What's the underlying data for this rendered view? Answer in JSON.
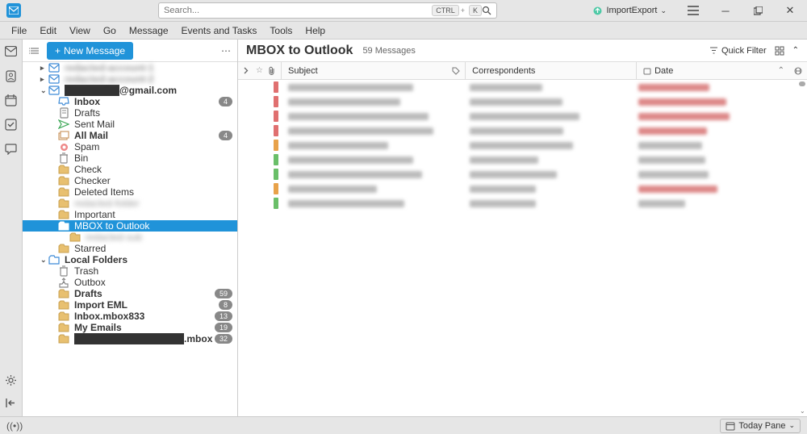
{
  "search": {
    "placeholder": "Search...",
    "kbd1": "CTRL",
    "kbd2": "K"
  },
  "titlebar": {
    "import_export": "ImportExport"
  },
  "menubar": [
    "File",
    "Edit",
    "View",
    "Go",
    "Message",
    "Events and Tasks",
    "Tools",
    "Help"
  ],
  "folder_toolbar": {
    "new_message": "New Message"
  },
  "accounts": [
    {
      "name": "redacted-account-1",
      "blurred": true
    },
    {
      "name": "redacted-account-2",
      "blurred": true
    },
    {
      "name": "@gmail.com",
      "bold": true,
      "folders": [
        {
          "label": "Inbox",
          "icon": "inbox",
          "bold": true,
          "badge": "4"
        },
        {
          "label": "Drafts",
          "icon": "drafts"
        },
        {
          "label": "Sent Mail",
          "icon": "sent"
        },
        {
          "label": "All Mail",
          "icon": "allmail",
          "bold": true,
          "badge": "4"
        },
        {
          "label": "Spam",
          "icon": "spam"
        },
        {
          "label": "Bin",
          "icon": "bin"
        },
        {
          "label": "Check",
          "icon": "folder"
        },
        {
          "label": "Checker",
          "icon": "folder"
        },
        {
          "label": "Deleted Items",
          "icon": "folder"
        },
        {
          "label": "redacted-folder",
          "icon": "folder",
          "blurred": true
        },
        {
          "label": "Important",
          "icon": "folder"
        },
        {
          "label": "MBOX to Outlook",
          "icon": "folder",
          "selected": true
        },
        {
          "label": "redacted-sub",
          "icon": "folder",
          "blurred": true,
          "indent": 3
        },
        {
          "label": "Starred",
          "icon": "folder"
        }
      ]
    }
  ],
  "local_folders": {
    "label": "Local Folders",
    "items": [
      {
        "label": "Trash",
        "icon": "bin"
      },
      {
        "label": "Outbox",
        "icon": "outbox"
      },
      {
        "label": "Drafts",
        "icon": "folder",
        "bold": true,
        "badge": "59"
      },
      {
        "label": "Import EML",
        "icon": "folder",
        "bold": true,
        "badge": "8"
      },
      {
        "label": "Inbox.mbox833",
        "icon": "folder",
        "bold": true,
        "badge": "13"
      },
      {
        "label": "My Emails",
        "icon": "folder",
        "bold": true,
        "badge": "19"
      },
      {
        "label": ".mbox",
        "icon": "folder",
        "bold": true,
        "badge": "32",
        "blurred_partial": true
      }
    ]
  },
  "content": {
    "title": "MBOX to Outlook",
    "count": "59 Messages",
    "quick_filter": "Quick Filter",
    "columns": {
      "subject": "Subject",
      "correspondents": "Correspondents",
      "date": "Date"
    }
  },
  "statusbar": {
    "today_pane": "Today Pane"
  }
}
